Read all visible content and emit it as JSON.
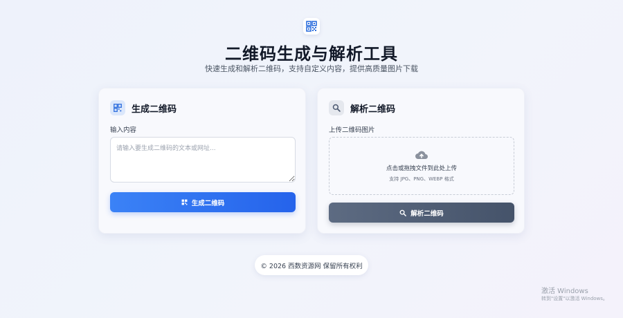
{
  "header": {
    "logo_icon": "qr-code-icon",
    "title": "二维码生成与解析工具",
    "subtitle": "快速生成和解析二维码，支持自定义内容，提供高质量图片下载"
  },
  "generate": {
    "icon": "qr-code-icon",
    "title": "生成二维码",
    "input_label": "输入内容",
    "input_placeholder": "请输入要生成二维码的文本或网址...",
    "input_value": "",
    "button_icon": "qr-code-icon",
    "button_label": "生成二维码"
  },
  "parse": {
    "icon": "search-icon",
    "title": "解析二维码",
    "upload_label": "上传二维码图片",
    "upload_icon": "cloud-upload-icon",
    "upload_hint": "点击或拖拽文件到此处上传",
    "upload_formats": "支持 JPG、PNG、WEBP 格式",
    "button_icon": "search-icon",
    "button_label": "解析二维码"
  },
  "footer": {
    "text": "© 2026 西数资源网 保留所有权利"
  },
  "watermark": {
    "line1": "激活 Windows",
    "line2": "转到\"设置\"以激活 Windows。"
  },
  "colors": {
    "primary": "#2563eb",
    "dark_button": "#4b5870",
    "background": "#f0f3fb",
    "card": "#f8f9fd"
  }
}
